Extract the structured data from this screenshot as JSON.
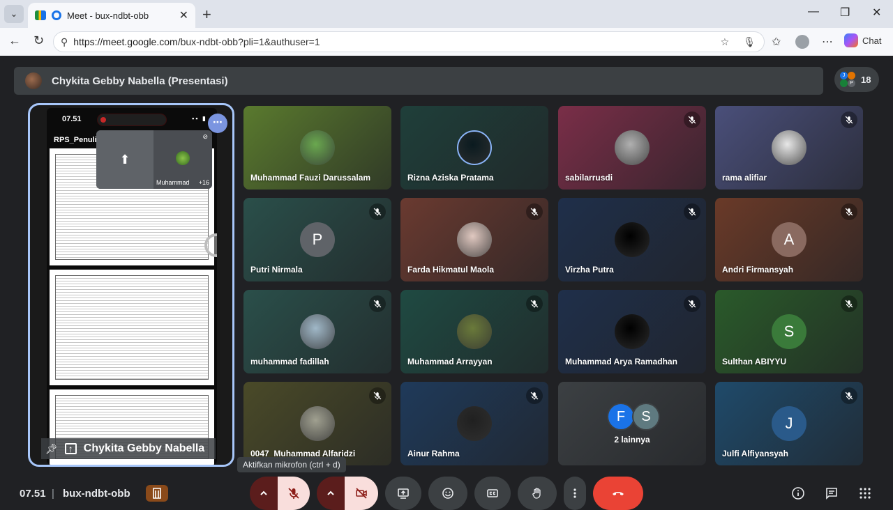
{
  "browser": {
    "tab_title": "Meet - bux-ndbt-obb",
    "url_host": "https://meet.google.com",
    "url_path": "/bux-ndbt-obb?pli=1&authuser=1",
    "chat_label": "Chat"
  },
  "meet": {
    "presentation_title": "Chykita Gebby Nabella (Presentasi)",
    "participants_count": "18",
    "participant_dot_a": "J",
    "participant_dot_b": "P",
    "presenter": {
      "name": "Chykita Gebby Nabella",
      "phone_time": "07.51",
      "doc_title": "RPS_Penuli",
      "pip_name": "Muhammad",
      "pip_more": "+16"
    },
    "tiles": [
      {
        "name": "Muhammad Fauzi Darussalam",
        "muted": false,
        "bg": "#5a7a2e",
        "avatar": "photo",
        "avatar_color": "#6aa84f"
      },
      {
        "name": "Rizna Aziska Pratama",
        "muted": false,
        "bg": "#1f3f3a",
        "avatar": "photo",
        "avatar_color": "#0a1a1f"
      },
      {
        "name": "sabilarrusdi",
        "muted": true,
        "bg": "#7a2e48",
        "avatar": "photo",
        "avatar_color": "#b0b0b0"
      },
      {
        "name": "rama alifiar",
        "muted": true,
        "bg": "#4a4f7a",
        "avatar": "photo",
        "avatar_color": "#e8e8e8"
      },
      {
        "name": "Putri Nirmala",
        "muted": true,
        "bg": "#2a4f4a",
        "avatar": "P",
        "avatar_color": "#5f6368"
      },
      {
        "name": "Farda Hikmatul Maola",
        "muted": true,
        "bg": "#6a3a30",
        "avatar": "photo",
        "avatar_color": "#e0c8c0"
      },
      {
        "name": "Virzha Putra",
        "muted": true,
        "bg": "#1f2f4a",
        "avatar": "photo",
        "avatar_color": "#000000"
      },
      {
        "name": "Andri Firmansyah",
        "muted": true,
        "bg": "#6a3a28",
        "avatar": "A",
        "avatar_color": "#8a6a60"
      },
      {
        "name": "muhammad fadillah",
        "muted": true,
        "bg": "#2a4f4a",
        "avatar": "photo",
        "avatar_color": "#a0b8c8"
      },
      {
        "name": "Muhammad Arrayyan",
        "muted": true,
        "bg": "#1f4a42",
        "avatar": "photo",
        "avatar_color": "#6a7a3a"
      },
      {
        "name": "Muhammad Arya Ramadhan",
        "muted": true,
        "bg": "#1f2f4a",
        "avatar": "photo",
        "avatar_color": "#000000"
      },
      {
        "name": "Sulthan ABIYYU",
        "muted": true,
        "bg": "#2a5a2a",
        "avatar": "S",
        "avatar_color": "#3a7a3a"
      },
      {
        "name": "0047_Muhammad Alfaridzi",
        "muted": true,
        "bg": "#4a4a28",
        "avatar": "photo",
        "avatar_color": "#a0a090"
      },
      {
        "name": "Ainur Rahma",
        "muted": true,
        "bg": "#1f3a5a",
        "avatar": "photo",
        "avatar_color": "#202020"
      },
      {
        "name": "2 lainnya",
        "muted": false,
        "bg": "#3c4043",
        "avatar": "group",
        "avatar_color": "#3c4043"
      },
      {
        "name": "Julfi Alfiyansyah",
        "muted": true,
        "bg": "#1f4a6a",
        "avatar": "J",
        "avatar_color": "#2a5a8a"
      }
    ],
    "others_a": "F",
    "others_b": "S",
    "tooltip": "Aktifkan mikrofon (ctrl + d)",
    "clock": "07.51",
    "separator": "|",
    "meeting_code": "bux-ndbt-obb"
  },
  "colors": {
    "accent": "#a8c7fa",
    "end_call": "#ea4335",
    "mic_off": "#f9dedc",
    "mic_off_dark": "#8c1d18"
  }
}
